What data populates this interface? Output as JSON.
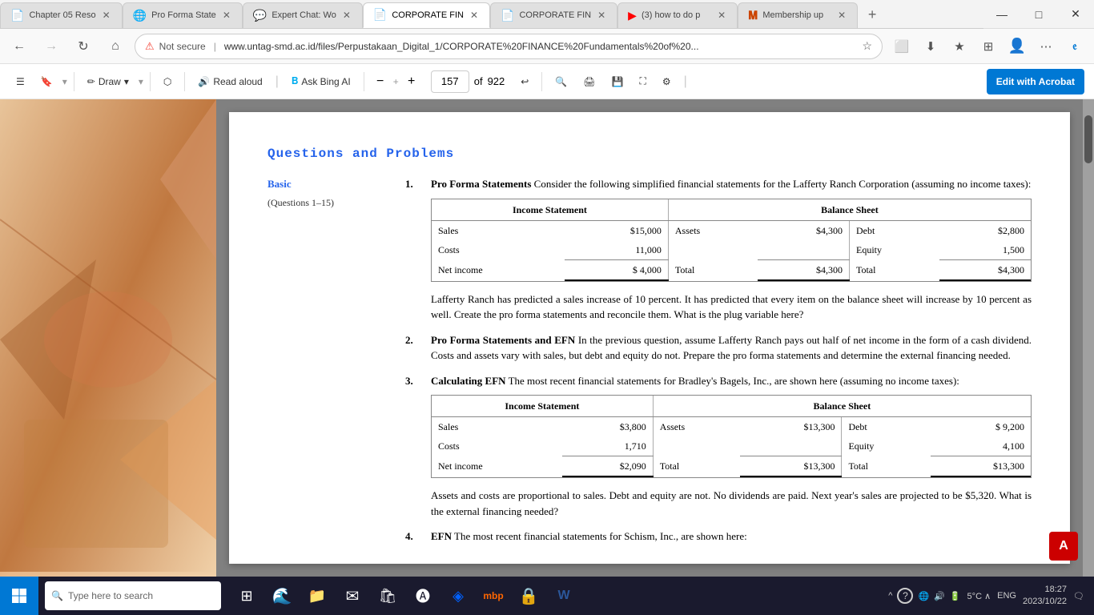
{
  "tabs": [
    {
      "id": "tab1",
      "label": "Chapter 05 Reso",
      "icon": "📄",
      "active": false,
      "closable": true,
      "color": "#fff"
    },
    {
      "id": "tab2",
      "label": "Pro Forma State",
      "icon": "🌐",
      "active": false,
      "closable": true
    },
    {
      "id": "tab3",
      "label": "Expert Chat: Wo",
      "icon": "💬",
      "active": false,
      "closable": true
    },
    {
      "id": "tab4",
      "label": "CORPORATE FIN",
      "icon": "📄",
      "active": true,
      "closable": true
    },
    {
      "id": "tab5",
      "label": "CORPORATE FIN",
      "icon": "📄",
      "active": false,
      "closable": true
    },
    {
      "id": "tab6",
      "label": "(3) how to do p",
      "icon": "▶",
      "active": false,
      "closable": true
    },
    {
      "id": "tab7",
      "label": "Membership up",
      "icon": "🅼",
      "active": false,
      "closable": true
    }
  ],
  "address_bar": {
    "protocol": "Not secure",
    "url": "www.untag-smd.ac.id/files/Perpustakaan_Digital_1/CORPORATE%20FINANCE%20Fundamentals%20of%20..."
  },
  "toolbar": {
    "draw_label": "Draw",
    "read_aloud_label": "Read aloud",
    "ask_bing_label": "Ask Bing AI",
    "page_current": "157",
    "page_total": "922",
    "edit_acrobat_label": "Edit with Acrobat",
    "zoom_minus": "−",
    "zoom_plus": "+"
  },
  "pdf": {
    "section_title": "Questions and Problems",
    "subsection": "Basic",
    "sub_questions": "(Questions 1–15)",
    "questions": [
      {
        "number": "1.",
        "title": "Pro Forma Statements",
        "body": "Consider the following simplified financial statements for the Lafferty Ranch Corporation (assuming no income taxes):",
        "table1": {
          "headers": [
            "Income Statement",
            "",
            "",
            "Balance Sheet",
            "",
            ""
          ],
          "rows": [
            [
              "Sales",
              "$15,000",
              "Assets",
              "$4,300",
              "Debt",
              "$2,800"
            ],
            [
              "Costs",
              "11,000",
              "",
              "",
              "Equity",
              "1,500"
            ],
            [
              "Net income",
              "$ 4,000",
              "Total",
              "$4,300",
              "Total",
              "$4,300"
            ]
          ]
        },
        "continuation": "Lafferty Ranch has predicted a sales increase of 10 percent. It has predicted that every item on the balance sheet will increase by 10 percent as well. Create the pro forma statements and reconcile them. What is the plug variable here?"
      },
      {
        "number": "2.",
        "title": "Pro Forma Statements and EFN",
        "body": "In the previous question, assume Lafferty Ranch pays out half of net income in the form of a cash dividend. Costs and assets vary with sales, but debt and equity do not. Prepare the pro forma statements and determine the external financing needed."
      },
      {
        "number": "3.",
        "title": "Calculating EFN",
        "body": "The most recent financial statements for Bradley's Bagels, Inc., are shown here (assuming no income taxes):",
        "table2": {
          "rows": [
            [
              "Sales",
              "$3,800",
              "Assets",
              "$13,300",
              "Debt",
              "$ 9,200"
            ],
            [
              "Costs",
              "1,710",
              "",
              "",
              "Equity",
              "4,100"
            ],
            [
              "Net income",
              "$2,090",
              "Total",
              "$13,300",
              "Total",
              "$13,300"
            ]
          ]
        },
        "continuation2": "Assets and costs are proportional to sales. Debt and equity are not. No dividends are paid. Next year's sales are projected to be $5,320. What is the external financing needed?"
      },
      {
        "number": "4.",
        "title": "EFN",
        "body": "The most recent financial statements for Schism, Inc., are shown here:"
      }
    ]
  },
  "taskbar": {
    "search_placeholder": "Type here to search",
    "time": "18:27",
    "date": "2023/10/22",
    "temperature": "5°C",
    "language": "ENG"
  },
  "window_controls": {
    "minimize": "—",
    "maximize": "□",
    "close": "✕"
  }
}
